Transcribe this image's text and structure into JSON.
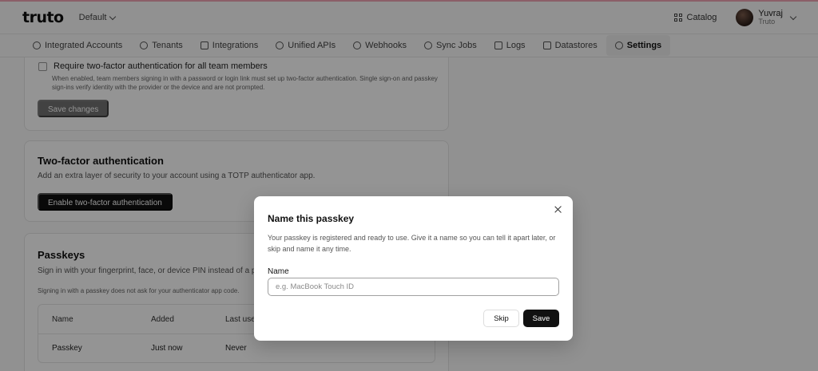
{
  "header": {
    "logo": "truto",
    "environment": "Default",
    "catalog": "Catalog",
    "user": {
      "name": "Yuvraj",
      "org": "Truto"
    }
  },
  "nav": [
    {
      "label": "Integrated Accounts",
      "icon": "cloud-icon"
    },
    {
      "label": "Tenants",
      "icon": "users-icon"
    },
    {
      "label": "Integrations",
      "icon": "grid-icon"
    },
    {
      "label": "Unified APIs",
      "icon": "globe-icon"
    },
    {
      "label": "Webhooks",
      "icon": "webhook-icon"
    },
    {
      "label": "Sync Jobs",
      "icon": "sync-icon"
    },
    {
      "label": "Logs",
      "icon": "list-icon"
    },
    {
      "label": "Datastores",
      "icon": "database-icon"
    },
    {
      "label": "Settings",
      "icon": "gear-icon",
      "active": true
    }
  ],
  "team_security": {
    "checkbox_label": "Require two-factor authentication for all team members",
    "help": "When enabled, team members signing in with a password or login link must set up two-factor authentication. Single sign-on and passkey sign-ins verify identity with the provider or the device and are not prompted.",
    "save_button": "Save changes"
  },
  "two_factor": {
    "title": "Two-factor authentication",
    "description": "Add an extra layer of security to your account using a TOTP authenticator app.",
    "button": "Enable two-factor authentication"
  },
  "passkeys": {
    "title": "Passkeys",
    "description": "Sign in with your fingerprint, face, or device PIN instead of a p",
    "note": "Signing in with a passkey does not ask for your authenticator app code.",
    "table": {
      "headers": {
        "name": "Name",
        "added": "Added",
        "last_used": "Last use"
      },
      "rows": [
        {
          "name": "Passkey",
          "added": "Just now",
          "last_used": "Never"
        }
      ]
    }
  },
  "modal": {
    "title": "Name this passkey",
    "description": "Your passkey is registered and ready to use. Give it a name so you can tell it apart later, or skip and name it any time.",
    "field_label": "Name",
    "placeholder": "e.g. MacBook Touch ID",
    "value": "",
    "skip_button": "Skip",
    "save_button": "Save"
  }
}
